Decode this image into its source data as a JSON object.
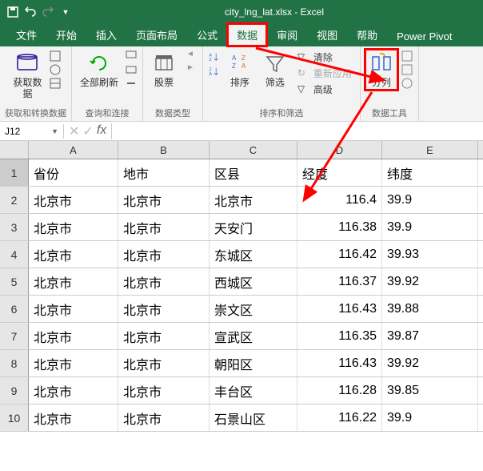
{
  "titlebar": {
    "filename": "city_lng_lat.xlsx - Excel"
  },
  "tabs": {
    "file": "文件",
    "home": "开始",
    "insert": "插入",
    "pagelayout": "页面布局",
    "formulas": "公式",
    "data": "数据",
    "review": "审阅",
    "view": "视图",
    "help": "帮助",
    "powerpivot": "Power Pivot"
  },
  "ribbon": {
    "group1": {
      "btn": "获取数\n据",
      "label": "获取和转换数据"
    },
    "group2": {
      "btn": "全部刷新",
      "label": "查询和连接"
    },
    "group3": {
      "btn": "股票",
      "label": "数据类型"
    },
    "group4": {
      "sort": "排序",
      "filter": "筛选",
      "clear": "清除",
      "reapply": "重新应用",
      "advanced": "高级",
      "label": "排序和筛选"
    },
    "group5": {
      "btn": "分列",
      "label": "数据工具"
    }
  },
  "namebox": {
    "ref": "J12",
    "fx": "fx"
  },
  "sheet": {
    "cols": [
      "A",
      "B",
      "C",
      "D",
      "E"
    ],
    "rows": [
      {
        "n": "1",
        "cells": [
          "省份",
          "地市",
          "区县",
          "经度",
          "纬度"
        ]
      },
      {
        "n": "2",
        "cells": [
          "北京市",
          "北京市",
          "北京市",
          "116.4",
          "39.9"
        ]
      },
      {
        "n": "3",
        "cells": [
          "北京市",
          "北京市",
          "天安门",
          "116.38",
          "39.9"
        ]
      },
      {
        "n": "4",
        "cells": [
          "北京市",
          "北京市",
          "东城区",
          "116.42",
          "39.93"
        ]
      },
      {
        "n": "5",
        "cells": [
          "北京市",
          "北京市",
          "西城区",
          "116.37",
          "39.92"
        ]
      },
      {
        "n": "6",
        "cells": [
          "北京市",
          "北京市",
          "崇文区",
          "116.43",
          "39.88"
        ]
      },
      {
        "n": "7",
        "cells": [
          "北京市",
          "北京市",
          "宣武区",
          "116.35",
          "39.87"
        ]
      },
      {
        "n": "8",
        "cells": [
          "北京市",
          "北京市",
          "朝阳区",
          "116.43",
          "39.92"
        ]
      },
      {
        "n": "9",
        "cells": [
          "北京市",
          "北京市",
          "丰台区",
          "116.28",
          "39.85"
        ]
      },
      {
        "n": "10",
        "cells": [
          "北京市",
          "北京市",
          "石景山区",
          "116.22",
          "39.9"
        ]
      }
    ]
  }
}
